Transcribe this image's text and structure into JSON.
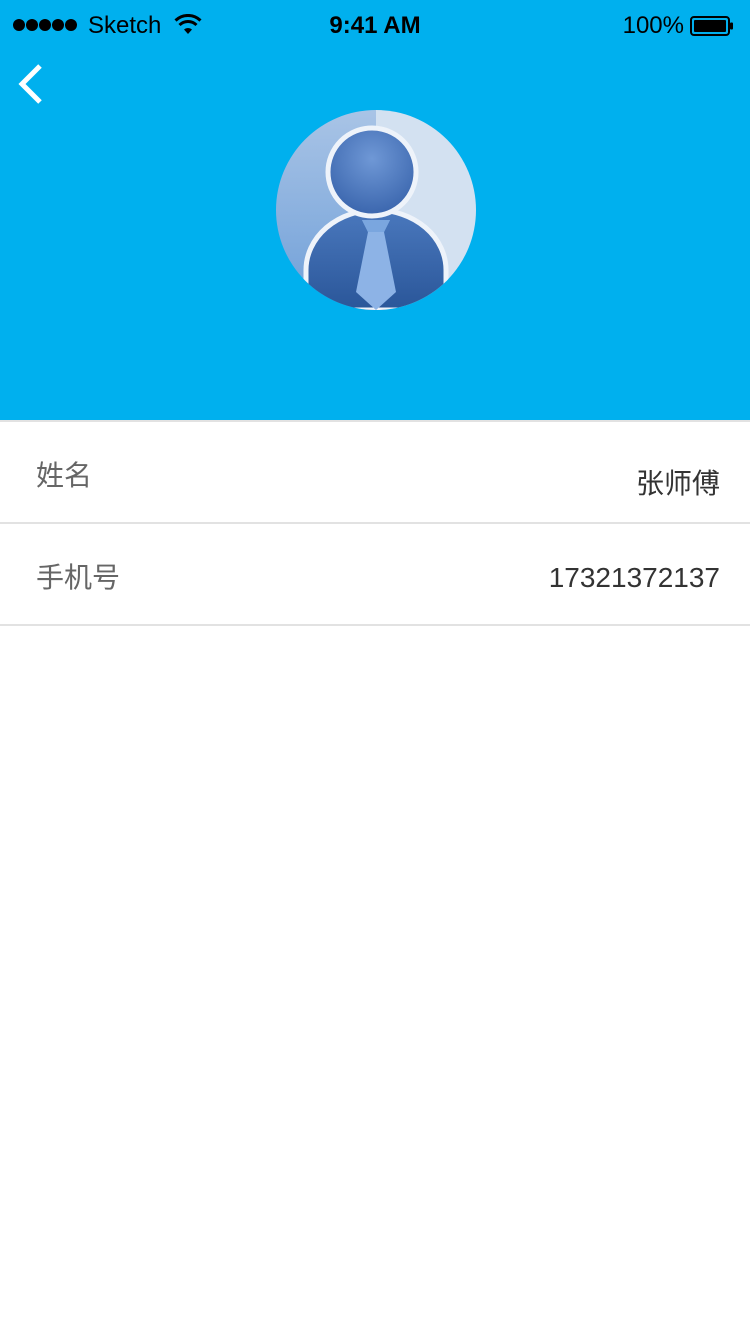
{
  "status_bar": {
    "carrier": "Sketch",
    "time": "9:41 AM",
    "battery": "100%"
  },
  "icons": {
    "back": "chevron-left-icon",
    "avatar": "user-avatar-icon",
    "wifi": "wifi-icon",
    "battery": "battery-icon",
    "signal": "signal-dots-icon"
  },
  "colors": {
    "header_bg": "#00b0ee",
    "label_text": "#666666",
    "value_text": "#333333",
    "divider": "#e2e2e2"
  },
  "profile": {
    "rows": [
      {
        "label": "姓名",
        "value": "张师傅"
      },
      {
        "label": "手机号",
        "value": "17321372137"
      }
    ]
  }
}
